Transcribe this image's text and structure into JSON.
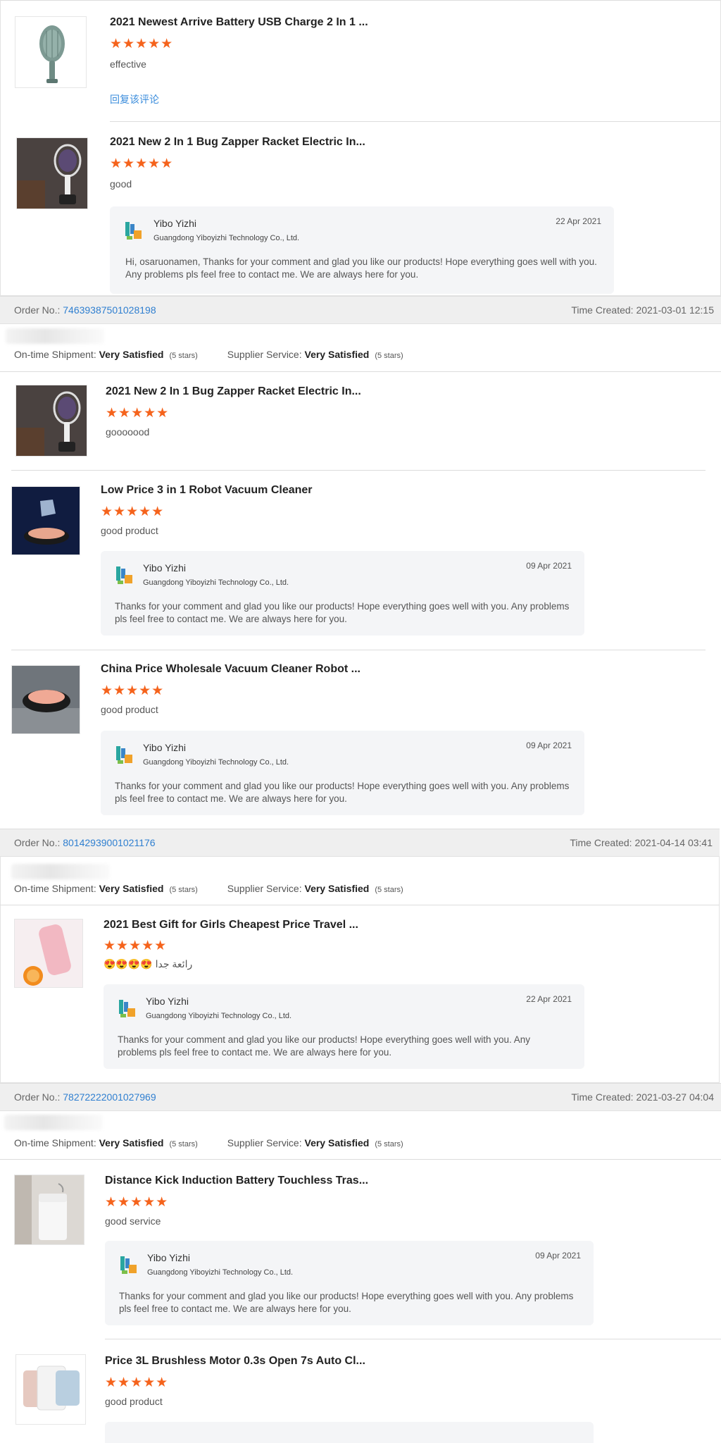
{
  "labels": {
    "order_no": "Order No.:",
    "time_created": "Time Created:",
    "ontime": "On-time Shipment:",
    "supplier": "Supplier Service:",
    "very_satisfied": "Very Satisfied",
    "five_stars": "(5 stars)",
    "reply_link": "回复该评论",
    "stars": "★★★★★"
  },
  "reply_common": {
    "name": "Yibo Yizhi",
    "company": "Guangdong Yiboyizhi Technology Co., Ltd.",
    "message": "Thanks for your comment and glad you like our products! Hope everything goes well with you. Any problems pls feel free to contact me. We are always here for you."
  },
  "reviews": [
    {
      "title": "2021 Newest Arrive Battery USB Charge 2 In 1 ...",
      "text": "effective"
    },
    {
      "title": "2021 New 2 In 1 Bug Zapper Racket Electric In...",
      "text": "good",
      "reply_date": "22 Apr 2021",
      "reply_message": "Hi, osaruonamen, Thanks for your comment and glad you like our products! Hope everything goes well with you. Any problems pls feel free to contact me. We are always here for you."
    },
    {
      "title": "2021 New 2 In 1 Bug Zapper Racket Electric In...",
      "text": "gooooood"
    },
    {
      "title": "Low Price 3 in 1 Robot Vacuum Cleaner",
      "text": "good product",
      "reply_date": "09 Apr 2021"
    },
    {
      "title": "China Price Wholesale Vacuum Cleaner Robot ...",
      "text": "good product",
      "reply_date": "09 Apr 2021"
    },
    {
      "title": "2021 Best Gift for Girls Cheapest Price Travel ...",
      "text": "😍😍😍😍 رائعة جدا",
      "reply_date": "22 Apr 2021"
    },
    {
      "title": "Distance Kick Induction Battery Touchless Tras...",
      "text": "good service",
      "reply_date": "09 Apr 2021"
    },
    {
      "title": "Price 3L Brushless Motor 0.3s Open 7s Auto Cl...",
      "text": "good product"
    }
  ],
  "orders": [
    {
      "number": "74639387501028198",
      "time": "2021-03-01 12:15"
    },
    {
      "number": "80142939001021176",
      "time": "2021-04-14 03:41"
    },
    {
      "number": "78272222001027969",
      "time": "2021-03-27 04:04"
    }
  ],
  "colors": {
    "accent_star": "#f5631c",
    "link": "#2f7fd0",
    "reply_bg": "#f4f5f7"
  }
}
